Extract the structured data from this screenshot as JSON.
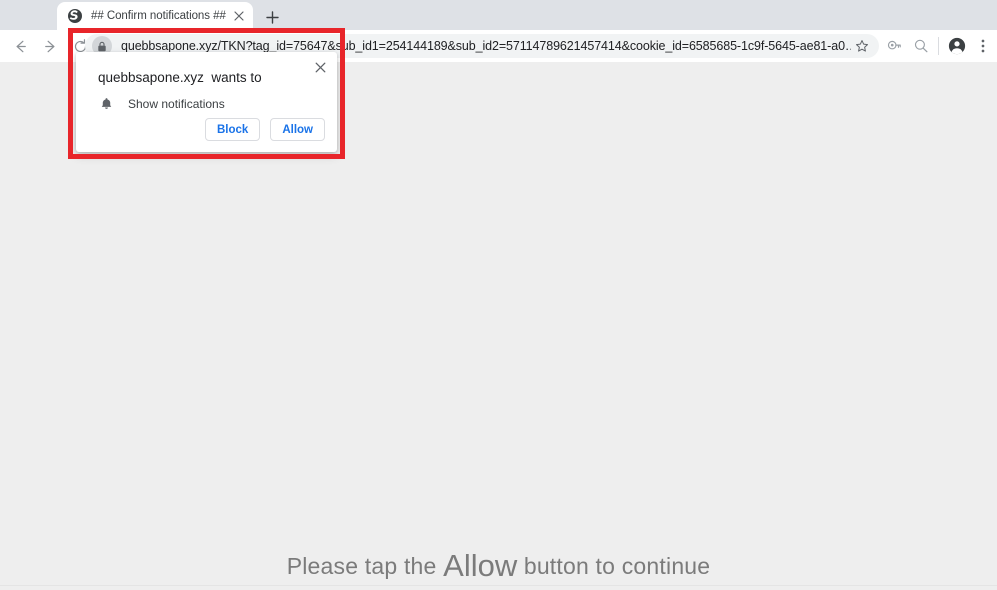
{
  "browser": {
    "tab": {
      "title": "## Confirm notifications ##",
      "favicon": "globe-icon",
      "close_label": "×"
    },
    "newtab_label": "+",
    "nav": {
      "back": "back-arrow-icon",
      "forward": "forward-arrow-icon",
      "reload": "reload-icon"
    },
    "omnibox": {
      "security_icon": "lock-icon",
      "url": "quebbsapone.xyz/TKN?tag_id=75647&sub_id1=254144189&sub_id2=57114789621457414&cookie_id=6585685-1c9f-5645-ae81-a0…",
      "bookmark_icon": "star-icon"
    },
    "toolbar_icons": {
      "extension": "extension-puzzle-icon",
      "zoom": "magnifier-icon",
      "profile": "profile-avatar-icon",
      "menu": "three-dot-menu-icon"
    }
  },
  "permission_dialog": {
    "title": "quebbsapone.xyz  wants to",
    "permission_icon": "bell-icon",
    "permission_label": "Show notifications",
    "block_label": "Block",
    "allow_label": "Allow",
    "close_label": "✕"
  },
  "page": {
    "cta_prefix": "Please tap the ",
    "cta_emphasis": "Allow",
    "cta_suffix": " button to continue"
  },
  "annotation": {
    "highlight_color": "#e8252a",
    "target": "permission-dialog-and-omnibox"
  }
}
